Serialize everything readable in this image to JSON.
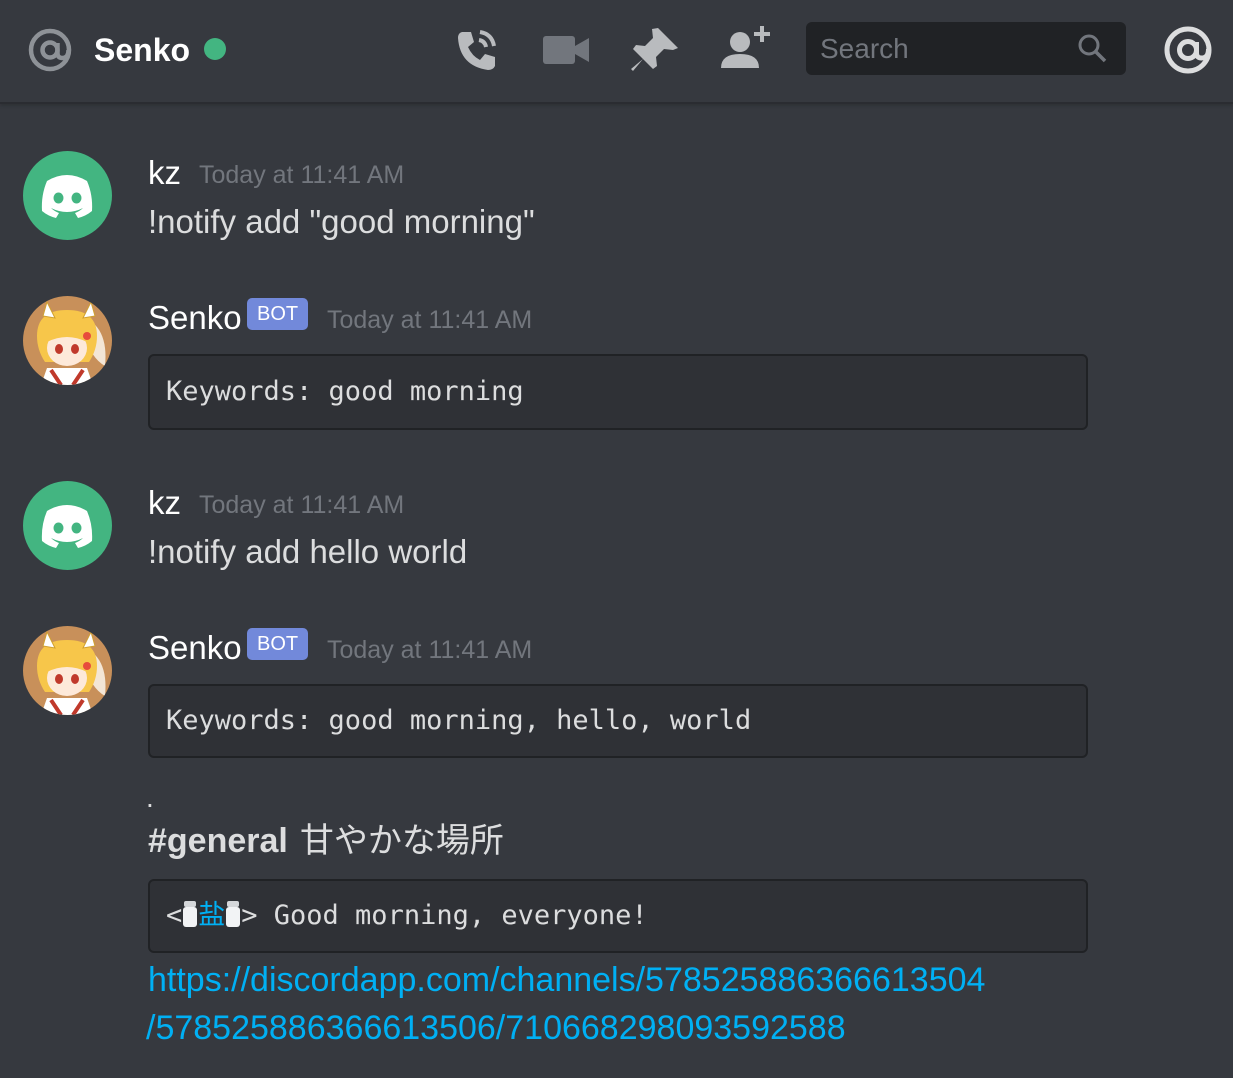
{
  "header": {
    "title": "Senko",
    "search_placeholder": "Search",
    "status_color": "#43b581"
  },
  "messages": [
    {
      "author": "kz",
      "timestamp": "Today at 11:41 AM",
      "text": "!notify add \"good morning\""
    },
    {
      "author": "Senko",
      "bot_tag": "BOT",
      "timestamp": "Today at 11:41 AM",
      "code": "Keywords: good morning"
    },
    {
      "author": "kz",
      "timestamp": "Today at 11:41 AM",
      "text": "!notify add hello world"
    },
    {
      "author": "Senko",
      "bot_tag": "BOT",
      "timestamp": "Today at 11:41 AM",
      "code": "Keywords: good morning, hello, world"
    }
  ],
  "notification": {
    "dot": ".",
    "channel": "#general",
    "topic": "甘やかな場所",
    "quote_prefix": "<",
    "quote_user": "盐",
    "quote_suffix": "> Good morning, everyone!",
    "link_line1": "https://discordapp.com/channels/578525886366613504",
    "link_line2": "/578525886366613506/710668298093592588"
  },
  "colors": {
    "background": "#36393f",
    "bot_tag": "#7289da",
    "link": "#00b0f4",
    "discord_green": "#43b581"
  }
}
